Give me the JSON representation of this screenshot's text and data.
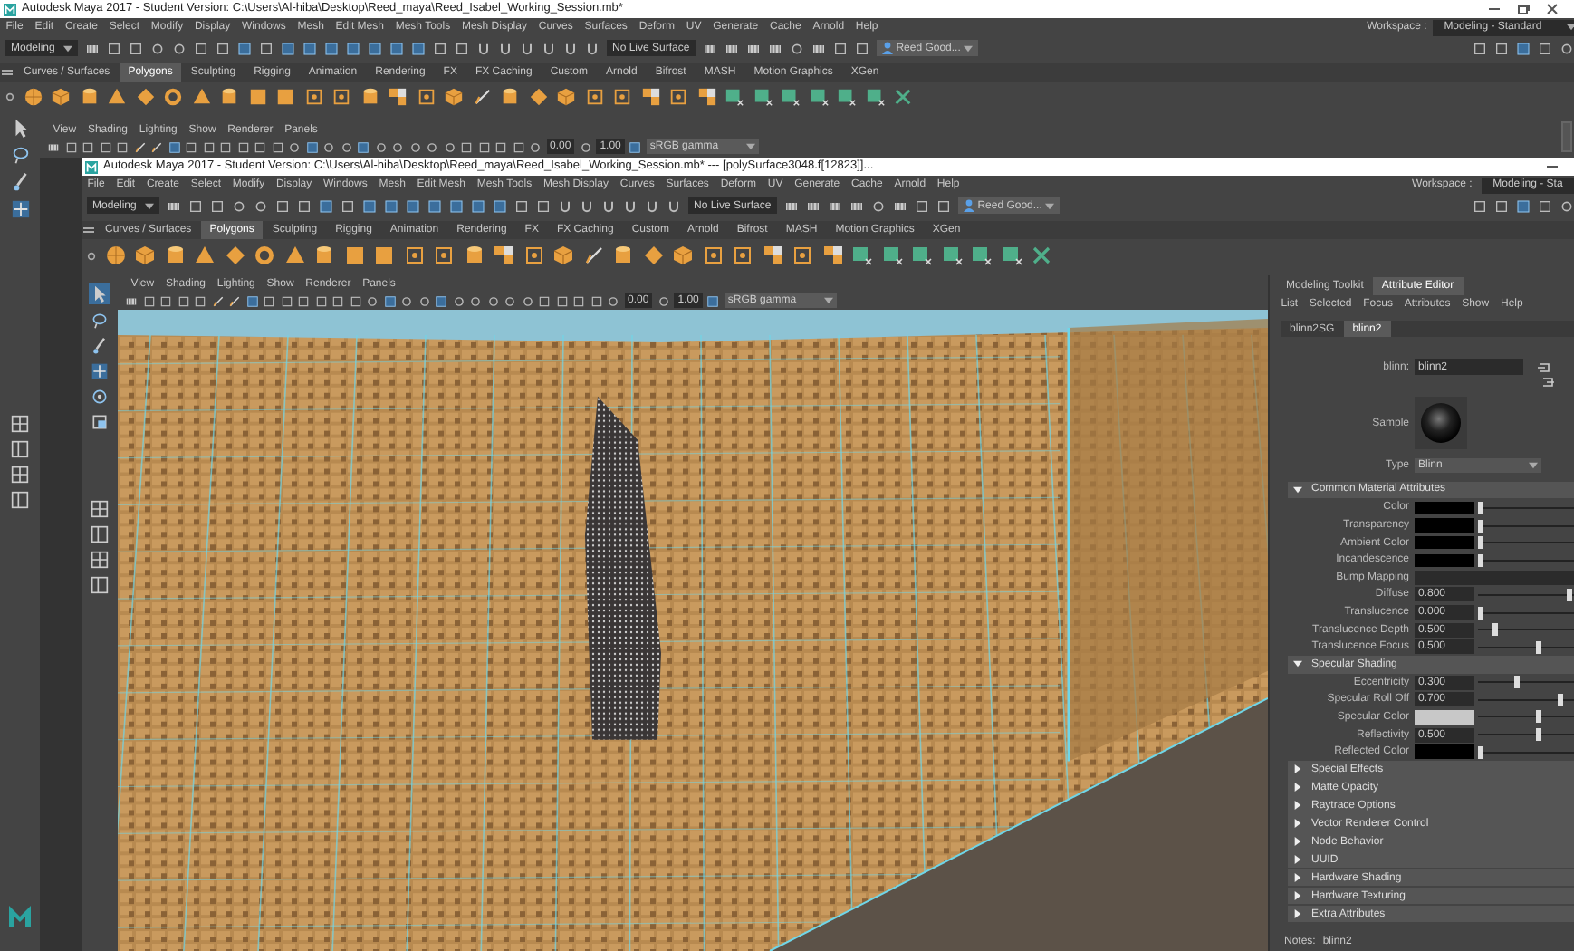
{
  "outer_window": {
    "title": "Autodesk Maya 2017 - Student Version: C:\\Users\\Al-hiba\\Desktop\\Reed_maya\\Reed_Isabel_Working_Session.mb*",
    "menu": [
      "File",
      "Edit",
      "Create",
      "Select",
      "Modify",
      "Display",
      "Windows",
      "Mesh",
      "Edit Mesh",
      "Mesh Tools",
      "Mesh Display",
      "Curves",
      "Surfaces",
      "Deform",
      "UV",
      "Generate",
      "Cache",
      "Arnold",
      "Help"
    ],
    "workspace": {
      "label": "Workspace :",
      "value": "Modeling - Standard"
    },
    "status_line": {
      "mode": "Modeling",
      "live_surface": "No Live Surface",
      "user": "Reed Good..."
    },
    "shelf_tabs": [
      {
        "label": "Curves / Surfaces",
        "selected": false
      },
      {
        "label": "Polygons",
        "selected": true
      },
      {
        "label": "Sculpting",
        "selected": false
      },
      {
        "label": "Rigging",
        "selected": false
      },
      {
        "label": "Animation",
        "selected": false
      },
      {
        "label": "Rendering",
        "selected": false
      },
      {
        "label": "FX",
        "selected": false
      },
      {
        "label": "FX Caching",
        "selected": false
      },
      {
        "label": "Custom",
        "selected": false
      },
      {
        "label": "Arnold",
        "selected": false
      },
      {
        "label": "Bifrost",
        "selected": false
      },
      {
        "label": "MASH",
        "selected": false
      },
      {
        "label": "Motion Graphics",
        "selected": false
      },
      {
        "label": "XGen",
        "selected": false
      }
    ],
    "panel_menu": [
      "View",
      "Shading",
      "Lighting",
      "Show",
      "Renderer",
      "Panels"
    ],
    "panel_toolbar": {
      "exposure": "0.00",
      "gamma": "1.00",
      "color_space": "sRGB gamma"
    }
  },
  "inner_window": {
    "title": "Autodesk Maya 2017 - Student Version: C:\\Users\\Al-hiba\\Desktop\\Reed_maya\\Reed_Isabel_Working_Session.mb*  ---  [polySurface3048.f[12823]]...",
    "menu": [
      "File",
      "Edit",
      "Create",
      "Select",
      "Modify",
      "Display",
      "Windows",
      "Mesh",
      "Edit Mesh",
      "Mesh Tools",
      "Mesh Display",
      "Curves",
      "Surfaces",
      "Deform",
      "UV",
      "Generate",
      "Cache",
      "Arnold",
      "Help"
    ],
    "workspace": {
      "label": "Workspace :",
      "value": "Modeling - Sta"
    },
    "status_line": {
      "mode": "Modeling",
      "live_surface": "No Live Surface",
      "user": "Reed Good..."
    },
    "shelf_tabs": [
      {
        "label": "Curves / Surfaces",
        "selected": false
      },
      {
        "label": "Polygons",
        "selected": true
      },
      {
        "label": "Sculpting",
        "selected": false
      },
      {
        "label": "Rigging",
        "selected": false
      },
      {
        "label": "Animation",
        "selected": false
      },
      {
        "label": "Rendering",
        "selected": false
      },
      {
        "label": "FX",
        "selected": false
      },
      {
        "label": "FX Caching",
        "selected": false
      },
      {
        "label": "Custom",
        "selected": false
      },
      {
        "label": "Arnold",
        "selected": false
      },
      {
        "label": "Bifrost",
        "selected": false
      },
      {
        "label": "MASH",
        "selected": false
      },
      {
        "label": "Motion Graphics",
        "selected": false
      },
      {
        "label": "XGen",
        "selected": false
      }
    ],
    "panel_menu": [
      "View",
      "Shading",
      "Lighting",
      "Show",
      "Renderer",
      "Panels"
    ],
    "panel_toolbar": {
      "exposure": "0.00",
      "gamma": "1.00",
      "color_space": "sRGB gamma"
    },
    "attribute_editor": {
      "tabs": [
        {
          "label": "Modeling Toolkit",
          "selected": false
        },
        {
          "label": "Attribute Editor",
          "selected": true
        }
      ],
      "menu": [
        "List",
        "Selected",
        "Focus",
        "Attributes",
        "Show",
        "Help"
      ],
      "node_tabs": [
        {
          "label": "blinn2SG",
          "selected": false
        },
        {
          "label": "blinn2",
          "selected": true
        }
      ],
      "node_field": {
        "label": "blinn:",
        "value": "blinn2"
      },
      "sample_label": "Sample",
      "type": {
        "label": "Type",
        "value": "Blinn"
      },
      "sections": [
        {
          "title": "Common Material Attributes",
          "expanded": true,
          "attributes": [
            {
              "kind": "color",
              "label": "Color",
              "color": "#000000",
              "level": 0
            },
            {
              "kind": "color",
              "label": "Transparency",
              "color": "#000000",
              "level": 0
            },
            {
              "kind": "color",
              "label": "Ambient Color",
              "color": "#000000",
              "level": 0
            },
            {
              "kind": "color",
              "label": "Incandescence",
              "color": "#000000",
              "level": 0
            },
            {
              "kind": "map",
              "label": "Bump Mapping"
            },
            {
              "kind": "number",
              "label": "Diffuse",
              "value": "0.800",
              "level": 0.97
            },
            {
              "kind": "number",
              "label": "Translucence",
              "value": "0.000",
              "level": 0
            },
            {
              "kind": "number",
              "label": "Translucence Depth",
              "value": "0.500",
              "level": 0.15
            },
            {
              "kind": "number",
              "label": "Translucence Focus",
              "value": "0.500",
              "level": 0.63
            }
          ]
        },
        {
          "title": "Specular Shading",
          "expanded": true,
          "attributes": [
            {
              "kind": "number",
              "label": "Eccentricity",
              "value": "0.300",
              "level": 0.4
            },
            {
              "kind": "number",
              "label": "Specular Roll Off",
              "value": "0.700",
              "level": 0.88
            },
            {
              "kind": "color",
              "label": "Specular Color",
              "color": "#c8c8c8",
              "level": 0.63
            },
            {
              "kind": "number",
              "label": "Reflectivity",
              "value": "0.500",
              "level": 0.63
            },
            {
              "kind": "color",
              "label": "Reflected Color",
              "color": "#000000",
              "level": 0
            }
          ]
        },
        {
          "title": "Special Effects",
          "expanded": false
        },
        {
          "title": "Matte Opacity",
          "expanded": false
        },
        {
          "title": "Raytrace Options",
          "expanded": false
        },
        {
          "title": "Vector Renderer Control",
          "expanded": false
        },
        {
          "title": "Node Behavior",
          "expanded": false
        },
        {
          "title": "UUID",
          "expanded": false
        },
        {
          "title": "Hardware Shading",
          "expanded": false
        },
        {
          "title": "Hardware Texturing",
          "expanded": false
        },
        {
          "title": "Extra Attributes",
          "expanded": false
        }
      ],
      "notes": {
        "label": "Notes:",
        "value": "blinn2"
      }
    }
  }
}
